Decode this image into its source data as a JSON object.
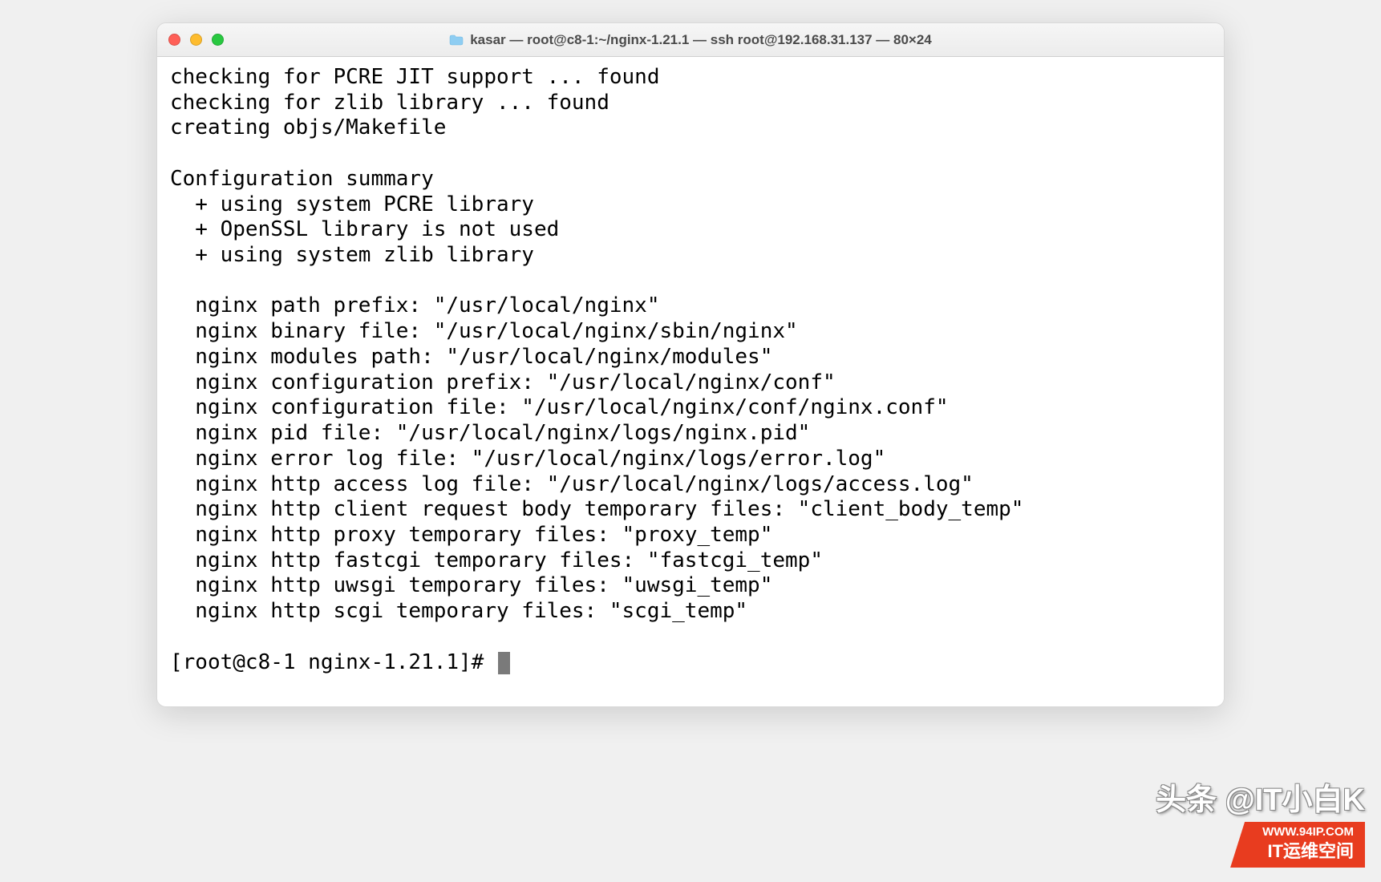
{
  "window": {
    "title": "kasar — root@c8-1:~/nginx-1.21.1 — ssh root@192.168.31.137 — 80×24"
  },
  "terminal": {
    "lines": [
      "checking for PCRE JIT support ... found",
      "checking for zlib library ... found",
      "creating objs/Makefile",
      "",
      "Configuration summary",
      "  + using system PCRE library",
      "  + OpenSSL library is not used",
      "  + using system zlib library",
      "",
      "  nginx path prefix: \"/usr/local/nginx\"",
      "  nginx binary file: \"/usr/local/nginx/sbin/nginx\"",
      "  nginx modules path: \"/usr/local/nginx/modules\"",
      "  nginx configuration prefix: \"/usr/local/nginx/conf\"",
      "  nginx configuration file: \"/usr/local/nginx/conf/nginx.conf\"",
      "  nginx pid file: \"/usr/local/nginx/logs/nginx.pid\"",
      "  nginx error log file: \"/usr/local/nginx/logs/error.log\"",
      "  nginx http access log file: \"/usr/local/nginx/logs/access.log\"",
      "  nginx http client request body temporary files: \"client_body_temp\"",
      "  nginx http proxy temporary files: \"proxy_temp\"",
      "  nginx http fastcgi temporary files: \"fastcgi_temp\"",
      "  nginx http uwsgi temporary files: \"uwsgi_temp\"",
      "  nginx http scgi temporary files: \"scgi_temp\"",
      ""
    ],
    "prompt": "[root@c8-1 nginx-1.21.1]# "
  },
  "watermark": {
    "top": "头条 @IT小白K",
    "url": "WWW.94IP.COM",
    "badge": "IT运维空间"
  }
}
